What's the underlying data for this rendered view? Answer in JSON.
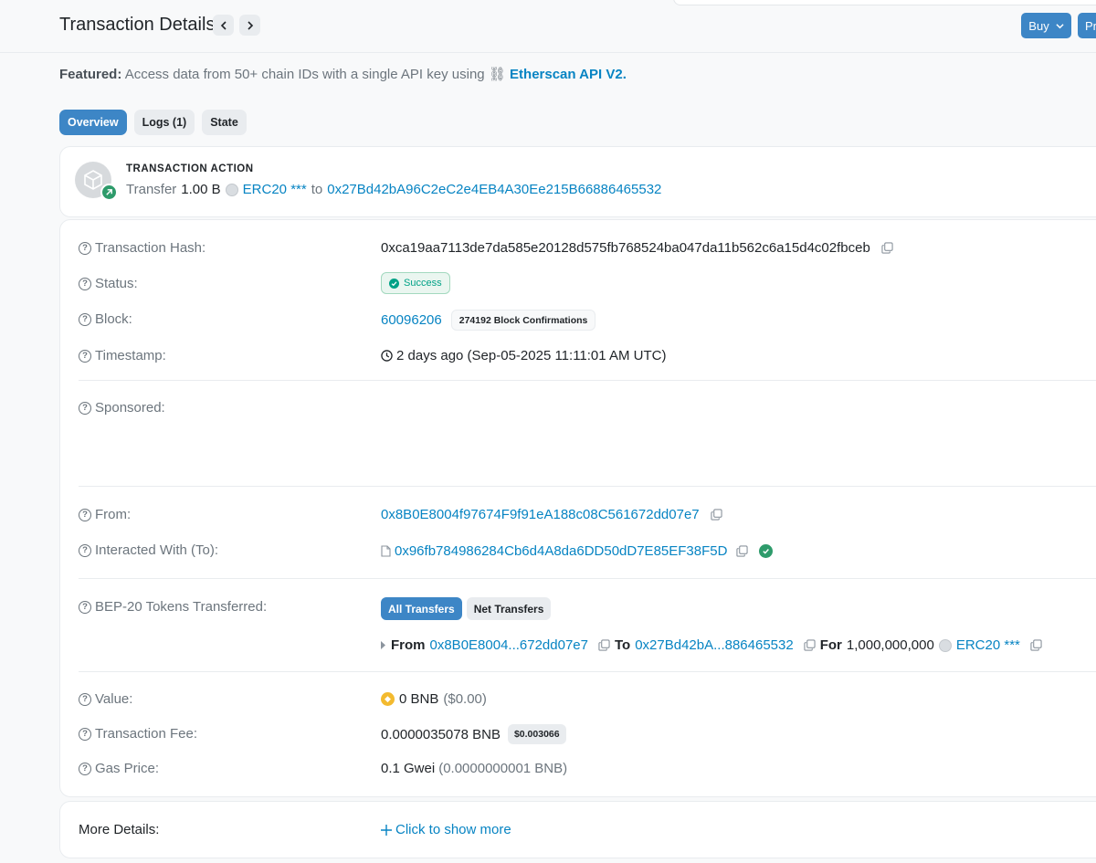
{
  "header": {
    "title": "Transaction Details",
    "buy_label": "Buy",
    "pr_label": "Pr"
  },
  "featured": {
    "prefix": "Featured:",
    "text": "Access data from 50+ chain IDs with a single API key using",
    "link": "Etherscan API V2."
  },
  "tabs": [
    {
      "label": "Overview",
      "active": true
    },
    {
      "label": "Logs (1)",
      "active": false
    },
    {
      "label": "State",
      "active": false
    }
  ],
  "action": {
    "label": "TRANSACTION ACTION",
    "verb": "Transfer",
    "amount": "1.00 B",
    "token": "ERC20 ***",
    "to_word": "to",
    "to_address": "0x27Bd42bA96C2eC2e4EB4A30Ee215B66886465532"
  },
  "details": {
    "tx_hash": {
      "label": "Transaction Hash:",
      "value": "0xca19aa7113de7da585e20128d575fb768524ba047da11b562c6a15d4c02fbceb"
    },
    "status": {
      "label": "Status:",
      "value": "Success"
    },
    "block": {
      "label": "Block:",
      "value": "60096206",
      "confirmations": "274192 Block Confirmations"
    },
    "timestamp": {
      "label": "Timestamp:",
      "value": "2 days ago (Sep-05-2025 11:11:01 AM UTC)"
    },
    "sponsored": {
      "label": "Sponsored:"
    },
    "from": {
      "label": "From:",
      "value": "0x8B0E8004f97674F9f91eA188c08C561672dd07e7"
    },
    "to": {
      "label": "Interacted With (To):",
      "value": "0x96fb784986284Cb6d4A8da6DD50dD7E85EF38F5D"
    },
    "tokens": {
      "label": "BEP-20 Tokens Transferred:",
      "all_label": "All Transfers",
      "net_label": "Net Transfers",
      "from_word": "From",
      "from_addr": "0x8B0E8004...672dd07e7",
      "to_word": "To",
      "to_addr": "0x27Bd42bA...886465532",
      "for_word": "For",
      "amount": "1,000,000,000",
      "token": "ERC20 ***"
    },
    "value": {
      "label": "Value:",
      "amount": "0 BNB",
      "usd": "($0.00)"
    },
    "fee": {
      "label": "Transaction Fee:",
      "value": "0.0000035078 BNB",
      "usd": "$0.003066"
    },
    "gas": {
      "label": "Gas Price:",
      "value": "0.1 Gwei",
      "bnb": "(0.0000000001 BNB)"
    }
  },
  "more": {
    "label": "More Details:",
    "link": "Click to show more"
  },
  "colors": {
    "accent": "#3d86c6",
    "link": "#0784c3",
    "success": "#00a186"
  }
}
